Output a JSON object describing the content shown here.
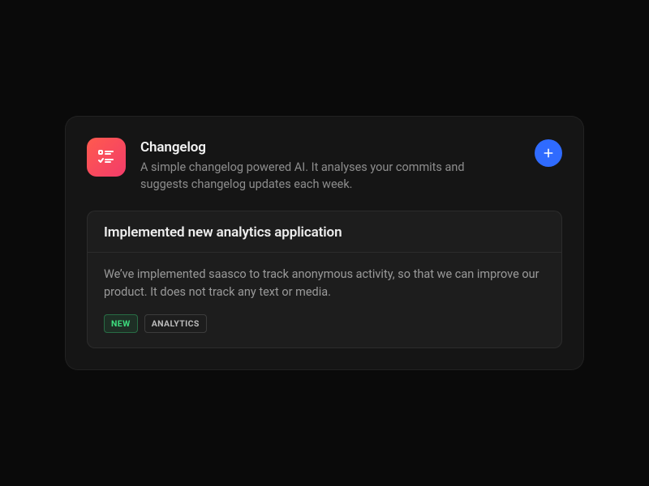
{
  "header": {
    "title": "Changelog",
    "subtitle": "A simple changelog powered AI. It analyses your commits and suggests changelog updates each week."
  },
  "entry": {
    "title": "Implemented new analytics application",
    "description": "We’ve implemented saasco to track anonymous activity, so that we can improve our product. It does not track any text or media.",
    "tags": [
      {
        "label": "NEW",
        "style": "new"
      },
      {
        "label": "ANALYTICS",
        "style": "plain"
      }
    ]
  },
  "colors": {
    "accent_blue": "#2f6bff",
    "icon_gradient_start": "#ff5a4e",
    "icon_gradient_end": "#f23c6a",
    "tag_new_text": "#3ddc7d"
  }
}
